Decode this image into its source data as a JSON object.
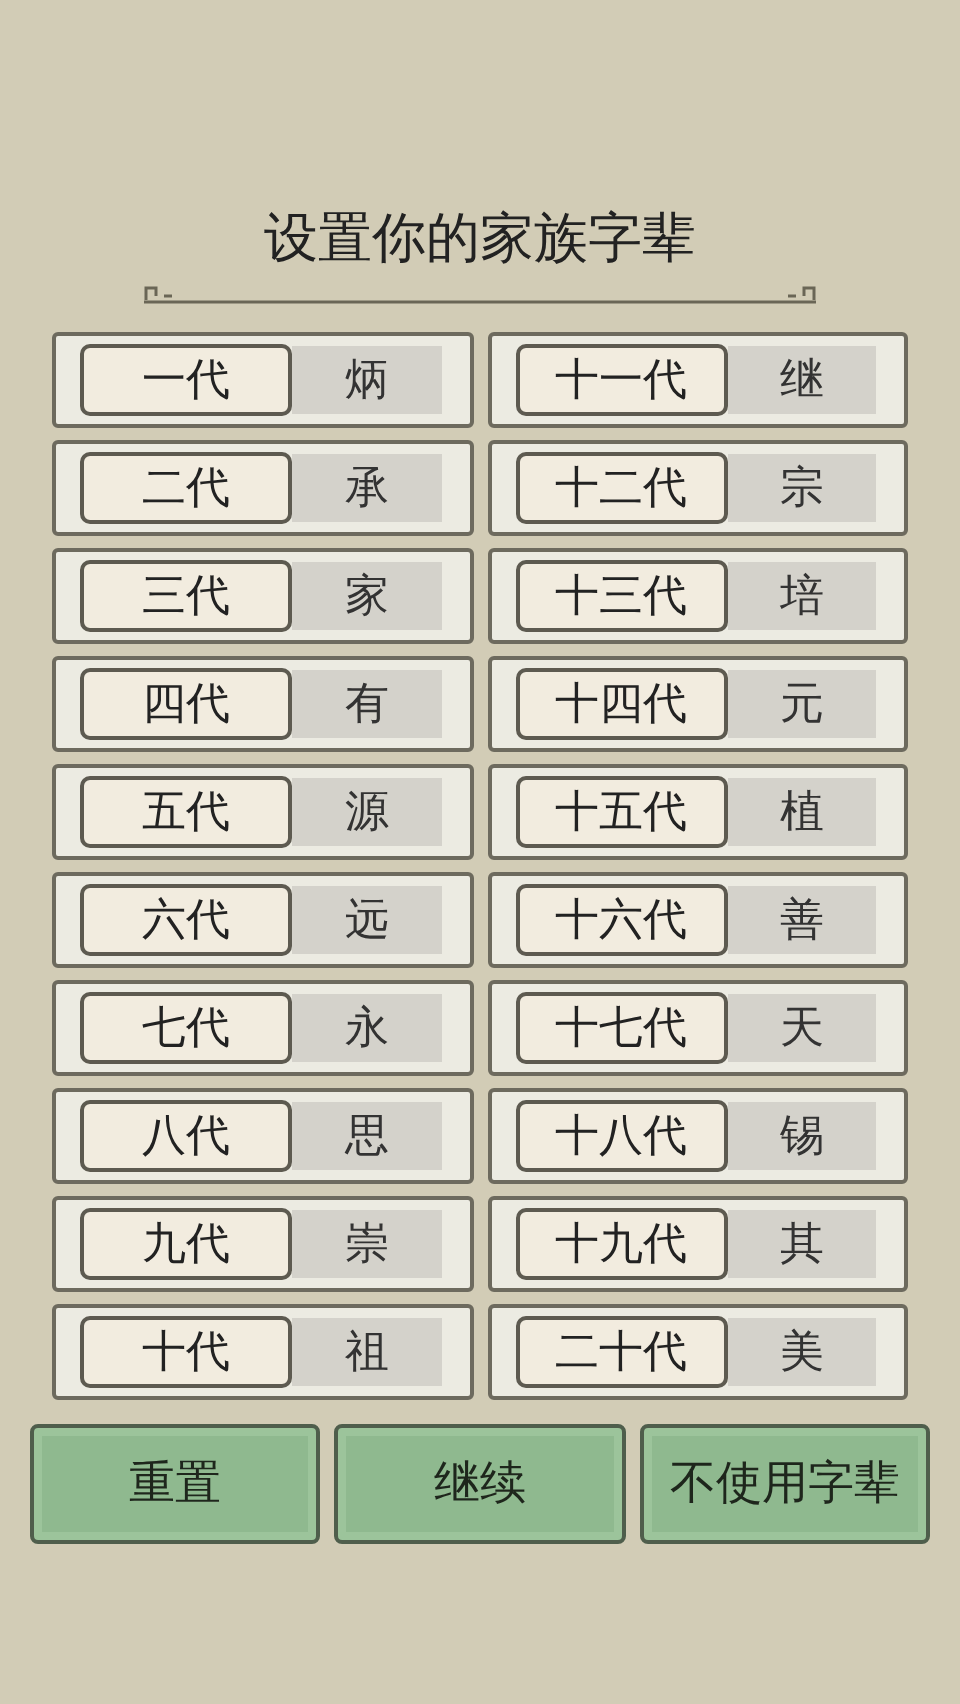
{
  "title": "设置你的家族字辈",
  "generations": [
    {
      "label": "一代",
      "name": "炳"
    },
    {
      "label": "二代",
      "name": "承"
    },
    {
      "label": "三代",
      "name": "家"
    },
    {
      "label": "四代",
      "name": "有"
    },
    {
      "label": "五代",
      "name": "源"
    },
    {
      "label": "六代",
      "name": "远"
    },
    {
      "label": "七代",
      "name": "永"
    },
    {
      "label": "八代",
      "name": "思"
    },
    {
      "label": "九代",
      "name": "崇"
    },
    {
      "label": "十代",
      "name": "祖"
    },
    {
      "label": "十一代",
      "name": "继"
    },
    {
      "label": "十二代",
      "name": "宗"
    },
    {
      "label": "十三代",
      "name": "培"
    },
    {
      "label": "十四代",
      "name": "元"
    },
    {
      "label": "十五代",
      "name": "植"
    },
    {
      "label": "十六代",
      "name": "善"
    },
    {
      "label": "十七代",
      "name": "天"
    },
    {
      "label": "十八代",
      "name": "锡"
    },
    {
      "label": "十九代",
      "name": "其"
    },
    {
      "label": "二十代",
      "name": "美"
    }
  ],
  "buttons": [
    "重置",
    "继续",
    "不使用字辈"
  ]
}
